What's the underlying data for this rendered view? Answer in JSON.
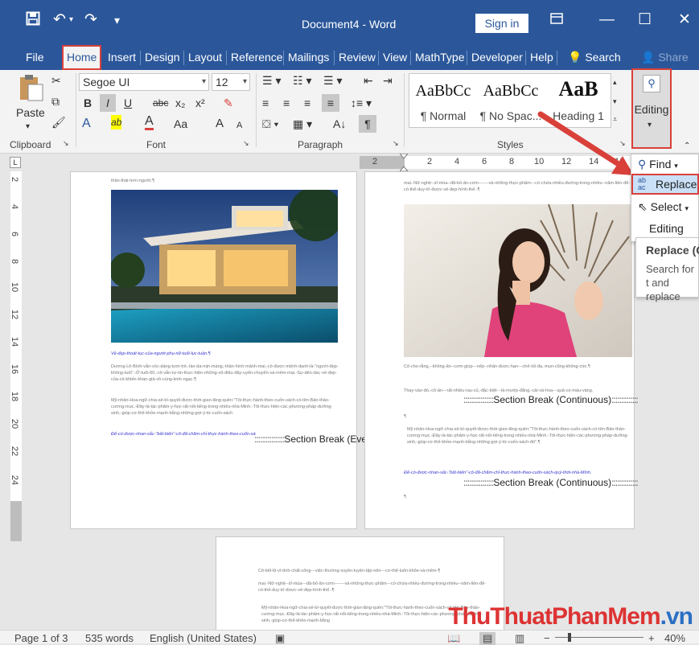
{
  "titlebar": {
    "title": "Document4 - Word",
    "signin": "Sign in",
    "save_icon": "save-icon",
    "undo_icon": "undo-icon",
    "redo_icon": "redo-icon"
  },
  "tabs": [
    "File",
    "Home",
    "Insert",
    "Design",
    "Layout",
    "Reference",
    "Mailings",
    "Review",
    "View",
    "MathType",
    "Developer",
    "Help"
  ],
  "tellme": "Search",
  "share": "Share",
  "ribbon": {
    "clipboard": {
      "label": "Clipboard",
      "paste": "Paste"
    },
    "font": {
      "label": "Font",
      "name": "Segoe UI",
      "size": "12",
      "bold": "B",
      "italic": "I",
      "underline": "U",
      "strike": "abc",
      "sub": "x₂",
      "sup": "x²",
      "case": "Aa",
      "grow": "A",
      "shrink": "A",
      "effects": "A",
      "color_a": "A",
      "highlight": "ab"
    },
    "paragraph": {
      "label": "Paragraph"
    },
    "styles": {
      "label": "Styles",
      "items": [
        {
          "preview": "AaBbCc",
          "name": "¶ Normal"
        },
        {
          "preview": "AaBbCc",
          "name": "¶ No Spac..."
        },
        {
          "preview": "AaB",
          "name": "Heading 1"
        }
      ]
    },
    "editing": {
      "label": "Editing"
    }
  },
  "ruler": {
    "h": [
      "2",
      "2",
      "4",
      "6",
      "8",
      "10",
      "12",
      "14",
      "16"
    ],
    "v": [
      "2",
      "4",
      "6",
      "8",
      "10",
      "12",
      "14",
      "16",
      "18",
      "20",
      "22",
      "24"
    ]
  },
  "editing_menu": {
    "find": "Find",
    "replace": "Replace",
    "select": "Select",
    "group": "Editing"
  },
  "tooltip": {
    "title": "Replace (C",
    "body": "Search for t and replace"
  },
  "pages": {
    "p1_top": "thân-thái-hơn-người.¶",
    "p1_caption": "Vẻ-đẹp-thoát-tục-của-người-phụ-nữ-tuổi-lục-tuần.¶",
    "p1_para1": "Dương-Lê-Bình-vẫn-vóc-dáng-tươi-trẻ,-làn-da-mịn-màng,-thân-hình-mảnh-mai,-có-được-mệnh-danh-là-\"người-đẹp-không-tuổi\".-Ở-tuổi-60,-cô-vẫn-tự-tin-thực-hiện-những-vũ-điệu-đầy-uyển-chuyển-và-mềm-mại.-Sự-dẻo-dai,-vẻ-đẹp-của-cô-khiến-khán-giả-vô-cùng-kinh-ngạc.¶",
    "p1_para2": "Mỹ-nhân-Hoa-ngữ-chia-sẻ-bí-quyết-được-thời-gian-lãng-quên:\"Tôi-thực-hành-theo-cuốn-sách-có-tên-Bản-thảo-cương-mục.-Đây-là-tác-phẩm-y-học-rất-nổi-tiếng-trong-nhiều-nhà-Minh.-Tôi-thực-hiện-các-phương-pháp-dưỡng-sinh,-giúp-cơ-thể-khỏe-mạnh-bằng-những-gợi-ý-từ-cuốn-sách",
    "p1_para2_blue": "Để-có-được-nhan-sắc-\"bất-biến\"-cô-đã-chăm-chỉ-thực-hành-theo-cuốn-sách-quý-thời-nhà-Minh.",
    "p1_break": "Section Break (Even Page)",
    "p2_top": "mai.-Nữ-nghệ--sĩ-mùa--đã-bỏ-ăn-cơm-------và-những-thực-phẩm---có-chứa-nhiều-đường-trong-nhiều--năm-liền-để-có-thể-duy-trì-được-vẻ-đẹp-hình-thể.-¶",
    "p2_para1": "Cô-cho-rằng,--không-ăn--cơm-giúp---nếp--nhân-được-hạn---chế-tối-đa,-mụn-cũng-không-còn.¶",
    "p2_para2": "Thay-vào-đó,-cô-ăn---rất-nhiều-rau-củ,-đặc-biệt---là-mướp-đắng,-cải-và-hoa---quả-có-màu-vàng.",
    "p2_break1": "Section Break (Continuous)",
    "p2_para3": "Mỹ-nhân-Hoa-ngữ-chia-sẻ-bí-quyết-được-thời-gian-lãng-quên:\"Tôi-thực-hành-theo-cuốn-sách-có-tên-Bản-thảo-cương-mục.-Đây-là-tác-phẩm-y-học-rất-nổi-tiếng-trong-nhiều-nhà-Minh.-Tôi-thực-hiện-các-phương-pháp-dưỡng-sinh,-giúp-cơ-thể-khỏe-mạnh-bằng-những-gợi-ý-từ-cuốn-sách-đó\".¶",
    "p2_para4_blue": "Để-có-được-nhan-sắc-\"bất-biến\"-cô-đã-chăm-chỉ-thực-hành-theo-cuốn-sách-quý-thời-nhà-Minh.",
    "p2_break2": "Section Break (Continuous)",
    "p3_para1": "Cô-tiết-lộ-vì-tính-chất-công---việc-thường-xuyên-luyện-tập-nên---cơ-thể-luôn-khỏe-và-mềm-¶",
    "p3_para2": "mai.-Nữ-nghệ--sĩ-mùa---đã-bỏ-ăn-cơm-------và-những-thực-phẩm---có-chứa-nhiều-đường-trong-nhiều--năm-liền-để-có-thể-duy-trì-được-vẻ-đẹp-hình-thể.-¶",
    "p3_para3": "Mỹ-nhân-Hoa-ngữ-chia-sẻ-bí-quyết-được-thời-gian-lãng-quên:\"Tôi-thực-hành-theo-cuốn-sách-có-tên-Bản-thảo-cương-mục.-Đây-là-tác-phẩm-y-học-rất-nổi-tiếng-trong-nhiều-nhà-Minh.-Tôi-thực-hiện-các-phương-pháp-dưỡng-sinh,-giúp-cơ-thể-khỏe-mạnh-bằng"
  },
  "status": {
    "page": "Page 1 of 3",
    "words": "535 words",
    "lang": "English (United States)",
    "zoom": "40%"
  },
  "watermark": {
    "main": "ThuThuatPhanMem",
    "tail": ".vn"
  },
  "colors": {
    "accent": "#2b579a",
    "highlight": "#d9403a"
  }
}
